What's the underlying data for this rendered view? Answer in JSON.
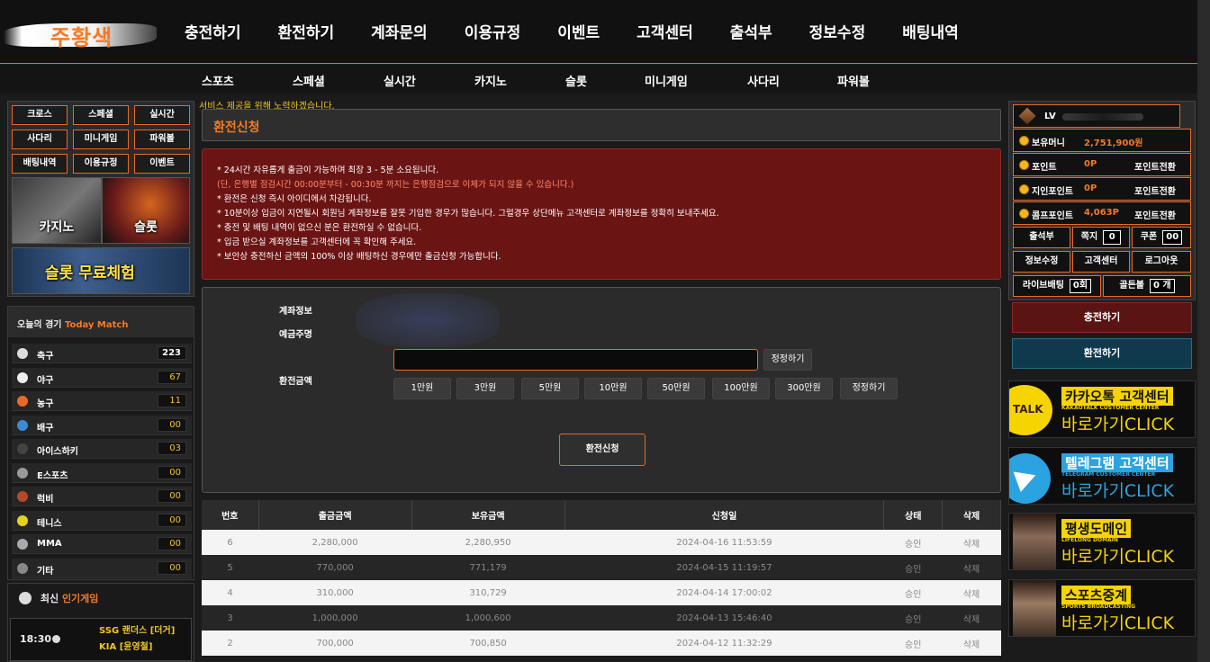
{
  "logo_text": "주황색",
  "main_nav": [
    "충전하기",
    "환전하기",
    "계좌문의",
    "이용규정",
    "이벤트",
    "고객센터",
    "출석부",
    "정보수정",
    "배팅내역"
  ],
  "sub_nav": [
    "스포츠",
    "스페셜",
    "실시간",
    "카지노",
    "슬롯",
    "미니게임",
    "사다리",
    "파워볼"
  ],
  "ticker": "서비스 제공을 위해 노력하겠습니다.",
  "left_grid": [
    "크로스",
    "스페셜",
    "실시간",
    "사다리",
    "미니게임",
    "파워볼",
    "배팅내역",
    "이용규정",
    "이벤트"
  ],
  "promos": {
    "casino": "카지노",
    "slot": "슬롯",
    "free_slot": "슬롯 무료체험"
  },
  "today_match": {
    "title": "오늘의 경기",
    "title_en": "Today Match"
  },
  "sports": [
    {
      "name": "축구",
      "count": "223",
      "icon": "soccer-ball-icon",
      "color": "#dddddd"
    },
    {
      "name": "야구",
      "count": "67",
      "icon": "baseball-icon",
      "color": "#eeeeee"
    },
    {
      "name": "농구",
      "count": "11",
      "icon": "basketball-icon",
      "color": "#e8692a"
    },
    {
      "name": "배구",
      "count": "00",
      "icon": "volleyball-icon",
      "color": "#3a8ad6"
    },
    {
      "name": "아이스하키",
      "count": "03",
      "icon": "hockey-puck-icon",
      "color": "#444444"
    },
    {
      "name": "E스포츠",
      "count": "00",
      "icon": "gamepad-icon",
      "color": "#999999"
    },
    {
      "name": "럭비",
      "count": "00",
      "icon": "rugby-ball-icon",
      "color": "#b34a2a"
    },
    {
      "name": "테니스",
      "count": "00",
      "icon": "tennis-ball-icon",
      "color": "#e6d21b"
    },
    {
      "name": "MMA",
      "count": "00",
      "icon": "glove-icon",
      "color": "#aaaaaa"
    },
    {
      "name": "기타",
      "count": "00",
      "icon": "olympic-rings-icon",
      "color": "#888888"
    }
  ],
  "popular": {
    "title": "최신",
    "title_en": "인기게임",
    "time": "18:30",
    "team1": "SSG 랜더스 [더거]",
    "team2": "KIA [윤영철]"
  },
  "page_title": "환전신청",
  "notices": [
    {
      "text": "* 24시간 자유롭게 출금이 가능하며 최장 3 - 5분 소요됩니다.",
      "red": false
    },
    {
      "text": "(단, 은행별 점검시간 00:00분부터 - 00:30분 까지는 은행점검으로 이체가 되지 않을 수 있습니다.)",
      "red": true
    },
    {
      "text": "* 환전은 신청 즉시 아이디에서 차감됩니다.",
      "red": false
    },
    {
      "text": "* 10분이상 입금이 지연될시 회원님 계좌정보를 잘못 기입한 경우가 많습니다. 그럴경우 상단메뉴 고객센터로 계좌정보를 정확히 보내주세요.",
      "red": false
    },
    {
      "text": "* 충전 및 배팅 내역이 없으신 분은 환전하실 수 없습니다.",
      "red": false
    },
    {
      "text": "* 입금 받으실 계좌정보를 고객센터에 꼭 확인해 주세요.",
      "red": false
    },
    {
      "text": "* 보안상 충전하신 금액의 100% 이상 배팅하신 경우에만 출금신청 가능합니다.",
      "red": false
    }
  ],
  "form": {
    "account_label": "계좌정보",
    "depositor_label": "예금주명",
    "amount_label": "환전금액",
    "amount_value": "",
    "correct_label": "정정하기",
    "quick": [
      "1만원",
      "3만원",
      "5만원",
      "10만원",
      "50만원",
      "100만원",
      "300만원",
      "정정하기"
    ],
    "submit": "환전신청"
  },
  "table": {
    "headers": [
      "번호",
      "출금금액",
      "보유금액",
      "신청일",
      "상태",
      "삭제"
    ],
    "rows": [
      [
        "6",
        "2,280,000",
        "2,280,950",
        "2024-04-16 11:53:59",
        "승인",
        "삭제"
      ],
      [
        "5",
        "770,000",
        "771,179",
        "2024-04-15 11:19:57",
        "승인",
        "삭제"
      ],
      [
        "4",
        "310,000",
        "310,729",
        "2024-04-14 17:00:02",
        "승인",
        "삭제"
      ],
      [
        "3",
        "1,000,000",
        "1,000,600",
        "2024-04-13 15:46:40",
        "승인",
        "삭제"
      ],
      [
        "2",
        "700,000",
        "700,850",
        "2024-04-12 11:32:29",
        "승인",
        "삭제"
      ]
    ]
  },
  "user": {
    "level": "LV",
    "money_label": "보유머니",
    "money": "2,751,900원",
    "point_label": "포인트",
    "point": "0P",
    "point_action": "포인트전환",
    "referral_label": "지인포인트",
    "referral": "0P",
    "referral_action": "포인트전환",
    "comp_label": "콤프포인트",
    "comp": "4,063P",
    "comp_action": "포인트전환",
    "attendance": "출석부",
    "note_label": "쪽지",
    "note_count": "0",
    "coupon_label": "쿠폰",
    "coupon_count": "00",
    "edit": "정보수정",
    "support": "고객센터",
    "logout": "로그아웃",
    "live_label": "라이브배팅",
    "live_count": "0회",
    "golden_label": "골든볼",
    "golden_count": "0 개"
  },
  "deposit_btn": "충전하기",
  "withdraw_btn": "환전하기",
  "banners": [
    {
      "title": "카카오톡 고객센터",
      "sub": "KAKAOTALK CUSTOMER CENTER",
      "cta": "바로가기CLICK"
    },
    {
      "title": "텔레그램 고객센터",
      "sub": "TELEGRAM CUSTOMER CENTER",
      "cta": "바로가기CLICK"
    },
    {
      "title": "평생도메인",
      "sub": "LIFELONG DOMAIN",
      "cta": "바로가기CLICK"
    },
    {
      "title": "스포츠중계",
      "sub": "SPORTS BROADCASTING",
      "cta": "바로가기CLICK"
    }
  ]
}
